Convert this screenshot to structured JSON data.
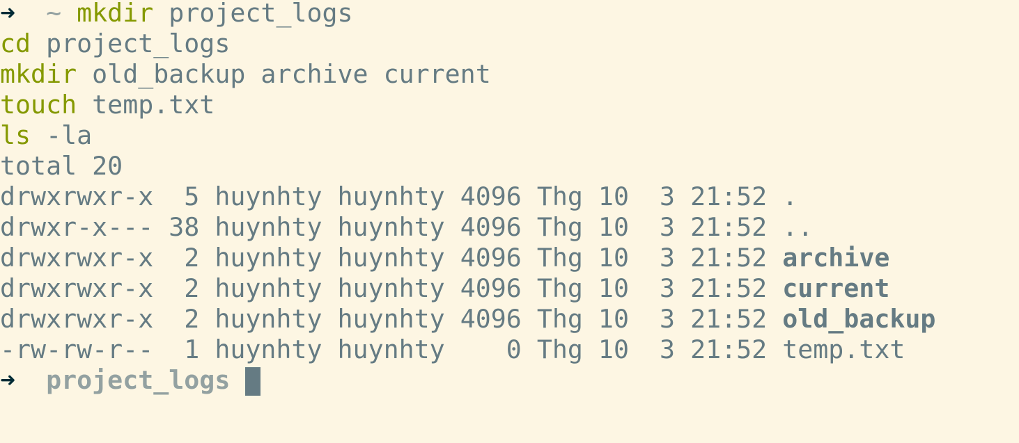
{
  "terminal": {
    "prompt_arrow": "➜",
    "home_symbol": "~",
    "commands": [
      {
        "cmd": "mkdir",
        "args": "project_logs"
      },
      {
        "cmd": "cd",
        "args": "project_logs"
      },
      {
        "cmd": "mkdir",
        "args": "old_backup archive current"
      },
      {
        "cmd": "touch",
        "args": "temp.txt"
      },
      {
        "cmd": "ls",
        "args": "-la"
      }
    ],
    "ls_total": "total 20",
    "listing": [
      {
        "perms": "drwxrwxr-x",
        "links": " 5",
        "owner": "huynhty",
        "group": "huynhty",
        "size": "4096",
        "date": "Thg 10  3 21:52",
        "name": "."
      },
      {
        "perms": "drwxr-x---",
        "links": "38",
        "owner": "huynhty",
        "group": "huynhty",
        "size": "4096",
        "date": "Thg 10  3 21:52",
        "name": ".."
      },
      {
        "perms": "drwxrwxr-x",
        "links": " 2",
        "owner": "huynhty",
        "group": "huynhty",
        "size": "4096",
        "date": "Thg 10  3 21:52",
        "name": "archive"
      },
      {
        "perms": "drwxrwxr-x",
        "links": " 2",
        "owner": "huynhty",
        "group": "huynhty",
        "size": "4096",
        "date": "Thg 10  3 21:52",
        "name": "current"
      },
      {
        "perms": "drwxrwxr-x",
        "links": " 2",
        "owner": "huynhty",
        "group": "huynhty",
        "size": "4096",
        "date": "Thg 10  3 21:52",
        "name": "old_backup"
      },
      {
        "perms": "-rw-rw-r--",
        "links": " 1",
        "owner": "huynhty",
        "group": "huynhty",
        "size": "   0",
        "date": "Thg 10  3 21:52",
        "name": "temp.txt"
      }
    ],
    "current_prompt_dir": "project_logs",
    "colors": {
      "background": "#fdf6e3",
      "text": "#657b83",
      "command": "#859900",
      "dim": "#93a1a1",
      "arrow": "#002b36"
    }
  }
}
